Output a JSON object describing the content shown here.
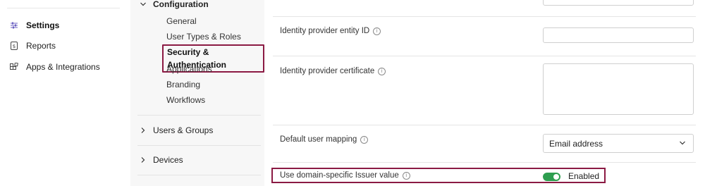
{
  "sidebar": {
    "items": [
      {
        "label": "Settings",
        "icon": "sliders-icon",
        "active": true
      },
      {
        "label": "Reports",
        "icon": "report-icon",
        "active": false
      },
      {
        "label": "Apps & Integrations",
        "icon": "apps-icon",
        "active": false
      }
    ]
  },
  "settings_nav": {
    "configuration": {
      "label": "Configuration",
      "items": [
        "General",
        "User Types & Roles",
        "Security & Authentication",
        "Applications",
        "Branding",
        "Workflows"
      ],
      "selected": "Security & Authentication"
    },
    "users_groups": {
      "label": "Users & Groups"
    },
    "devices": {
      "label": "Devices"
    }
  },
  "form": {
    "entity_id": {
      "label": "Identity provider entity ID",
      "value": ""
    },
    "certificate": {
      "label": "Identity provider certificate",
      "value": ""
    },
    "user_mapping": {
      "label": "Default user mapping",
      "value": "Email address"
    },
    "issuer": {
      "label": "Use domain-specific Issuer value",
      "toggle_state": "Enabled",
      "on": true
    }
  },
  "colors": {
    "highlight": "#8b1a43",
    "toggle_on": "#2e9e4f"
  }
}
